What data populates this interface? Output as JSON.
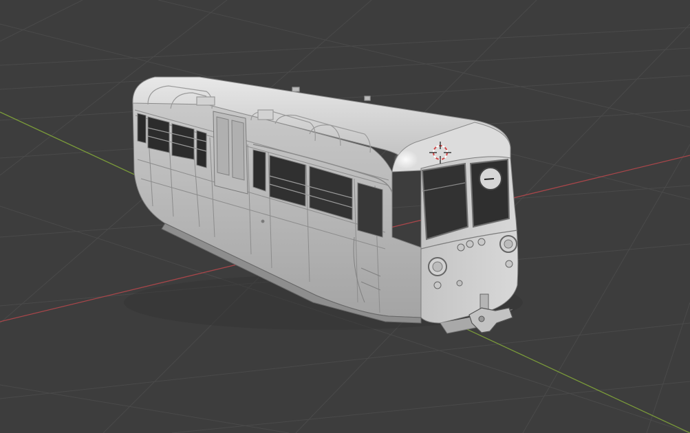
{
  "viewport": {
    "background": "#3d3d3d",
    "grid_color": "#4a4a4a",
    "x_axis_color": "#a8464a",
    "y_axis_color": "#7a9a3a"
  },
  "scene": {
    "object": "railcar-model",
    "shading": "solid",
    "object_color": "#b4b4b4",
    "cursor_icon": "3d-cursor-icon"
  }
}
